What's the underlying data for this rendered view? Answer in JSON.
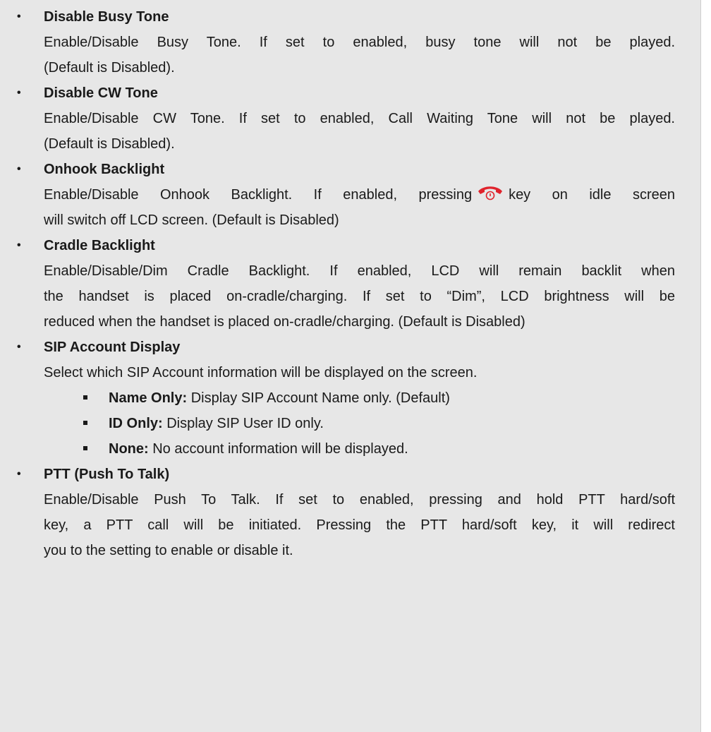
{
  "items": [
    {
      "title": "Disable Busy Tone",
      "desc_line1": "Enable/Disable Busy Tone. If set to enabled, busy tone will not be played.",
      "desc_line2": "(Default is Disabled)."
    },
    {
      "title": "Disable CW Tone",
      "desc_line1": "Enable/Disable CW Tone. If set to enabled, Call Waiting Tone will not be played.",
      "desc_line2": "(Default is Disabled)."
    },
    {
      "title": "Onhook Backlight",
      "desc_line1_a": "Enable/Disable Onhook Backlight. If enabled, pressing",
      "desc_line1_b": "key on idle screen",
      "desc_line2": "will switch off LCD screen. (Default is Disabled)",
      "icon": "hangup-key-icon"
    },
    {
      "title": "Cradle Backlight",
      "desc_line1": "Enable/Disable/Dim Cradle Backlight. If enabled, LCD will remain backlit when",
      "desc_line2": "the handset is placed on-cradle/charging. If set to “Dim”, LCD brightness will be",
      "desc_line3": "reduced when the handset is placed on-cradle/charging. (Default is Disabled)"
    },
    {
      "title": "SIP Account Display",
      "desc_line1": "Select which SIP Account information will be displayed on the screen.",
      "options": [
        {
          "term": "Name Only:",
          "text": " Display SIP Account Name only. (Default)"
        },
        {
          "term": "ID Only:",
          "text": " Display SIP User ID only."
        },
        {
          "term": "None:",
          "text": " No account information will be displayed."
        }
      ]
    },
    {
      "title": "PTT (Push To Talk)",
      "desc_line1": "Enable/Disable Push To Talk. If set to enabled, pressing and hold PTT hard/soft",
      "desc_line2": "key, a PTT call will be initiated. Pressing the PTT hard/soft key, it will redirect",
      "desc_line3": "you to the setting to enable or disable it."
    }
  ],
  "bullet_char": "•",
  "colors": {
    "background": "#e7e7e7",
    "text": "#1a1a1a",
    "hangup_icon": "#e0232c"
  }
}
